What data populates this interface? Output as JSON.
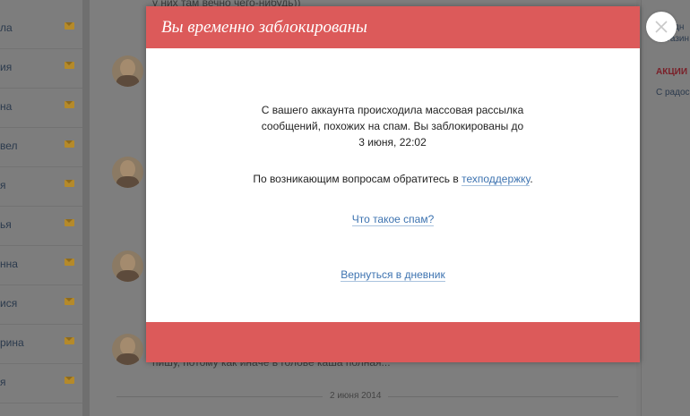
{
  "sidebar": {
    "items": [
      {
        "label": "ла"
      },
      {
        "label": "ия"
      },
      {
        "label": "на"
      },
      {
        "label": "вел"
      },
      {
        "label": "я"
      },
      {
        "label": "ья"
      },
      {
        "label": "нна"
      },
      {
        "label": "ися"
      },
      {
        "label": "рина"
      },
      {
        "label": "я"
      }
    ]
  },
  "feed": {
    "top_text": "у них там вечно чего-нибудь))",
    "last_text": "пишу, потому как иначе в голове каша полная...",
    "date_separator": "2 июня 2014"
  },
  "right_sidebar": {
    "fashion": "• Модн",
    "shops": "магазин",
    "promo_heading": "АКЦИИ",
    "promo_text": "С радос"
  },
  "modal": {
    "title": "Вы временно заблокированы",
    "message": "С вашего аккаунта происходила массовая рассылка сообщений, похожих на спам. Вы заблокированы до 3 июня, 22:02",
    "question_prefix": "По возникающим вопросам обратитесь в ",
    "support_link": "техподдержку",
    "question_suffix": ".",
    "spam_link": "Что такое спам?",
    "back_link": "Вернуться в дневник",
    "close_icon": "close-icon"
  },
  "colors": {
    "accent_red": "#dc5a5a",
    "link_blue": "#3d73b0"
  }
}
